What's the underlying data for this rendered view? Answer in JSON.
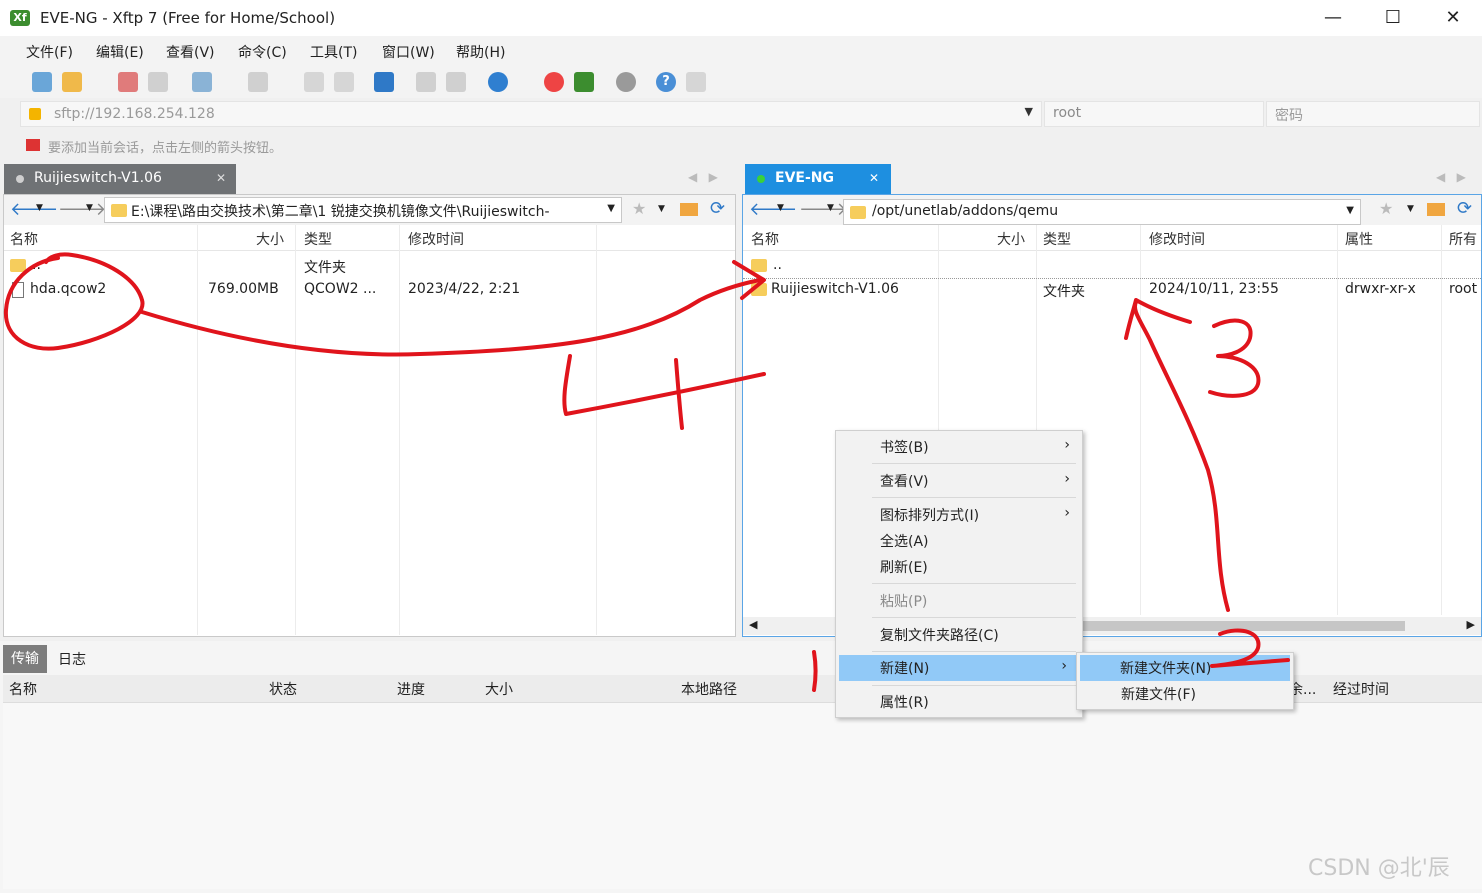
{
  "window": {
    "title": "EVE-NG - Xftp 7 (Free for Home/School)",
    "app_icon": "xftp-icon"
  },
  "menu": [
    "文件(F)",
    "编辑(E)",
    "查看(V)",
    "命令(C)",
    "工具(T)",
    "窗口(W)",
    "帮助(H)"
  ],
  "address": {
    "url": "sftp://192.168.254.128",
    "user": "root",
    "password_placeholder": "密码"
  },
  "hint": "要添加当前会话，点击左侧的箭头按钮。",
  "left": {
    "tab": "Ruijieswitch-V1.06",
    "path": "E:\\课程\\路由交换技术\\第二章\\1 锐捷交换机镜像文件\\Ruijieswitch-",
    "headers": {
      "name": "名称",
      "size": "大小",
      "type": "类型",
      "modified": "修改时间"
    },
    "rows": [
      {
        "name": "..",
        "size": "",
        "type": "文件夹",
        "modified": ""
      },
      {
        "name": "hda.qcow2",
        "size": "769.00MB",
        "type": "QCOW2 ...",
        "modified": "2023/4/22, 2:21"
      }
    ]
  },
  "right": {
    "tab": "EVE-NG",
    "path": "/opt/unetlab/addons/qemu",
    "headers": {
      "name": "名称",
      "size": "大小",
      "type": "类型",
      "modified": "修改时间",
      "attr": "属性",
      "owner": "所有"
    },
    "rows": [
      {
        "name": "..",
        "size": "",
        "type": "",
        "modified": "",
        "attr": "",
        "owner": ""
      },
      {
        "name": "Ruijieswitch-V1.06",
        "size": "",
        "type": "文件夹",
        "modified": "2024/10/11, 23:55",
        "attr": "drwxr-xr-x",
        "owner": "root"
      }
    ]
  },
  "bottom": {
    "tabs": [
      "传输",
      "日志"
    ],
    "headers": {
      "name": "名称",
      "status": "状态",
      "progress": "进度",
      "size": "大小",
      "local": "本地路径",
      "remain": "剩余...",
      "elapsed": "经过时间"
    }
  },
  "context_menu": {
    "items": [
      "书签(B)",
      "查看(V)",
      "图标排列方式(I)",
      "全选(A)",
      "刷新(E)",
      "粘贴(P)",
      "复制文件夹路径(C)",
      "新建(N)",
      "属性(R)"
    ],
    "submenu": [
      "新建文件夹(N)",
      "新建文件(F)"
    ]
  },
  "annotations": {
    "n1": "1",
    "n2": "2",
    "n3": "3",
    "n4": "4"
  },
  "watermark": "CSDN @北'辰"
}
